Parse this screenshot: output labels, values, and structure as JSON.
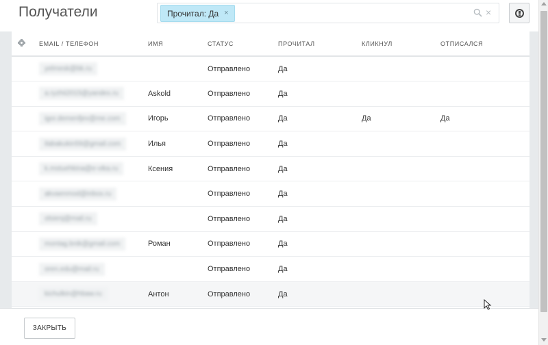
{
  "header": {
    "title": "Получатели",
    "filter_chip": "Прочитал: Да",
    "chip_close": "×",
    "search_value": "",
    "clear_glyph": "×"
  },
  "table": {
    "columns": [
      "EMAIL / ТЕЛЕФОН",
      "ИМЯ",
      "СТАТУС",
      "ПРОЧИТАЛ",
      "КЛИКНУЛ",
      "ОТПИСАЛСЯ"
    ],
    "rows": [
      {
        "email": "yelmesk@bk.ru",
        "name": "",
        "status": "Отправлено",
        "read": "Да",
        "clicked": "",
        "unsubscribed": ""
      },
      {
        "email": "a.ryzhii2015@yandex.ru",
        "name": "Askold",
        "status": "Отправлено",
        "read": "Да",
        "clicked": "",
        "unsubscribed": ""
      },
      {
        "email": "igor.demenfjev@me.com",
        "name": "Игорь",
        "status": "Отправлено",
        "read": "Да",
        "clicked": "Да",
        "unsubscribed": "Да"
      },
      {
        "email": "ilabakukin59@gmail.com",
        "name": "Илья",
        "status": "Отправлено",
        "read": "Да",
        "clicked": "",
        "unsubscribed": ""
      },
      {
        "email": "k.mstuehkina@e-vika.ru",
        "name": "Ксения",
        "status": "Отправлено",
        "read": "Да",
        "clicked": "",
        "unsubscribed": ""
      },
      {
        "email": "akvaenmod@inbox.ru",
        "name": "",
        "status": "Отправлено",
        "read": "Да",
        "clicked": "",
        "unsubscribed": ""
      },
      {
        "email": "olsienj@mail.ru",
        "name": "",
        "status": "Отправлено",
        "read": "Да",
        "clicked": "",
        "unsubscribed": ""
      },
      {
        "email": "montag.bnik@gmail.com",
        "name": "Роман",
        "status": "Отправлено",
        "read": "Да",
        "clicked": "",
        "unsubscribed": ""
      },
      {
        "email": "oren.edu@mail.ru",
        "name": "",
        "status": "Отправлено",
        "read": "Да",
        "clicked": "",
        "unsubscribed": ""
      },
      {
        "email": "kichulkin@hbaw.ru",
        "name": "Антон",
        "status": "Отправлено",
        "read": "Да",
        "clicked": "",
        "unsubscribed": ""
      }
    ]
  },
  "footer": {
    "close_label": "ЗАКРЫТЬ"
  },
  "colors": {
    "chip_bg": "#bfe8f7",
    "content_bg": "#e7eaec"
  }
}
